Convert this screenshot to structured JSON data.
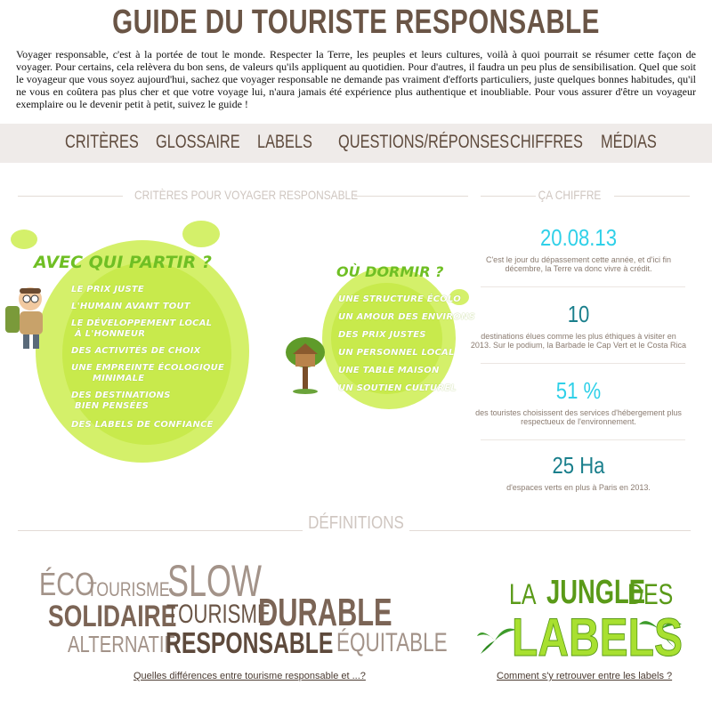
{
  "header": {
    "title": "GUIDE DU TOURISTE RESPONSABLE",
    "intro": "Voyager responsable, c'est à la portée de tout le monde. Respecter la Terre, les peuples et leurs cultures, voilà à quoi pourrait se résumer cette façon de voyager. Pour certains, cela relèvera du bon sens, de valeurs qu'ils appliquent au quotidien. Pour d'autres, il faudra un peu plus de sensibilisation. Quel que soit le voyageur que vous soyez aujourd'hui, sachez que voyager responsable ne demande pas vraiment d'efforts particuliers, juste quelques bonnes habitudes, qu'il ne vous en coûtera pas plus cher et que votre voyage lui, n'aura jamais été expérience plus authentique et inoubliable. Pour vous assurer d'être un voyageur exemplaire ou le devenir petit à petit, suivez le guide !"
  },
  "nav": [
    "CRITÈRES",
    "GLOSSAIRE",
    "LABELS",
    "QUESTIONS/RÉPONSES",
    "CHIFFRES",
    "MÉDIAS"
  ],
  "criteres": {
    "section_title": "CRITÈRES POUR VOYAGER RESPONSABLE",
    "avec_qui": {
      "heading": "AVEC QUI PARTIR ?",
      "items": [
        "LE PRIX JUSTE",
        "L'HUMAIN AVANT TOUT",
        "LE DÉVELOPPEMENT LOCAL",
        "À L'HONNEUR",
        "DES ACTIVITÉS DE CHOIX",
        "UNE EMPREINTE ÉCOLOGIQUE",
        "MINIMALE",
        "DES DESTINATIONS",
        "BIEN PENSÉES",
        "DES LABELS DE CONFIANCE"
      ]
    },
    "ou_dormir": {
      "heading": "OÙ DORMIR ?",
      "items": [
        "UNE STRUCTURE ÉCOLO",
        "UN AMOUR DES ENVIRONS",
        "DES PRIX JUSTES",
        "UN PERSONNEL LOCAL",
        "UNE TABLE MAISON",
        "UN SOUTIEN CULTUREL"
      ]
    }
  },
  "chiffres": {
    "section_title": "ÇA CHIFFRE",
    "stats": [
      {
        "value": "20.08.13",
        "color": "#2fd0e8",
        "desc1": "C'est le jour du dépassement cette année, et d'ici fin",
        "desc2": "décembre, la Terre va donc vivre à crédit."
      },
      {
        "value": "10",
        "color": "#1a7f8c",
        "desc1": "destinations élues comme les plus éthiques à visiter en",
        "desc2": "2013. Sur le podium, la Barbade le Cap Vert et le Costa Rica"
      },
      {
        "value": "51 %",
        "color": "#2fd0e8",
        "desc1": "des touristes choisissent des services d'hébergement plus",
        "desc2": "respectueux de l'environnement."
      },
      {
        "value": "25 Ha",
        "color": "#1a7f8c",
        "desc1": "d'espaces verts en plus à Paris en 2013.",
        "desc2": ""
      }
    ]
  },
  "definitions": {
    "section_title": "DÉFINITIONS",
    "words": {
      "eco": "ÉCO",
      "tourisme1": "TOURISME",
      "slow": "SLOW",
      "solidaire": "SOLIDAIRE",
      "tourisme2": "TOURISME",
      "durable": "DURABLE",
      "alternatif": "ALTERNATIF",
      "responsable": "RESPONSABLE",
      "equitable": "ÉQUITABLE"
    },
    "link_left": "Quelles différences entre tourisme responsable et ...?",
    "jungle": {
      "line1a": "LA",
      "line1b": "JUNGLE",
      "line1c": "DES",
      "line2": "LABELS"
    },
    "link_right": "Comment s'y retrouver entre les labels ?"
  }
}
